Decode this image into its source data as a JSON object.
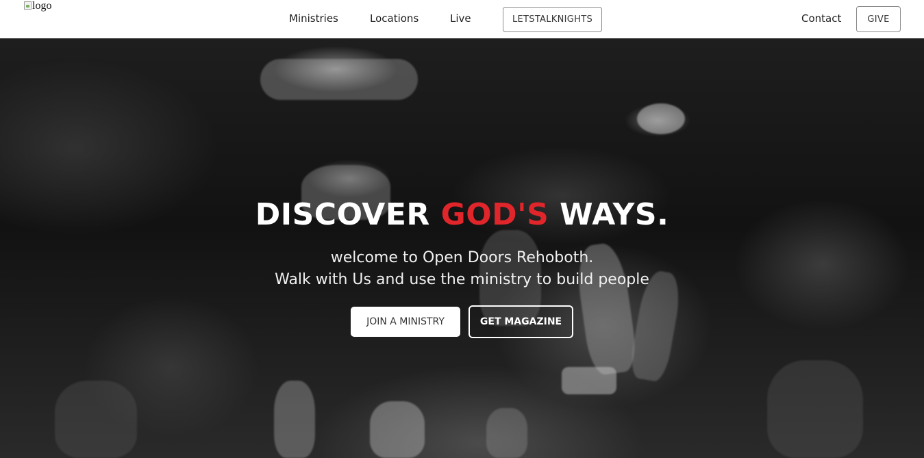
{
  "navbar": {
    "logo_alt": "logo",
    "links": {
      "ministries": "Ministries",
      "locations": "Locations",
      "live": "Live",
      "contact": "Contact"
    },
    "letstalk_label": "LETSTALKNIGHTS",
    "give_label": "GIVE"
  },
  "hero": {
    "title_part1": "DISCOVER ",
    "title_accent": "GOD'S",
    "title_part2": " WAYS.",
    "subtitle_line1": "welcome to Open Doors Rehoboth.",
    "subtitle_line2": "Walk with Us and use the ministry to build people",
    "join_label": "JOIN A MINISTRY",
    "magazine_label": "GET MAGAZINE",
    "background_description_icon": "worship-hands-image"
  },
  "colors": {
    "accent_red": "#e0262a",
    "nav_bg": "#ffffff",
    "hero_text": "#ffffff"
  }
}
